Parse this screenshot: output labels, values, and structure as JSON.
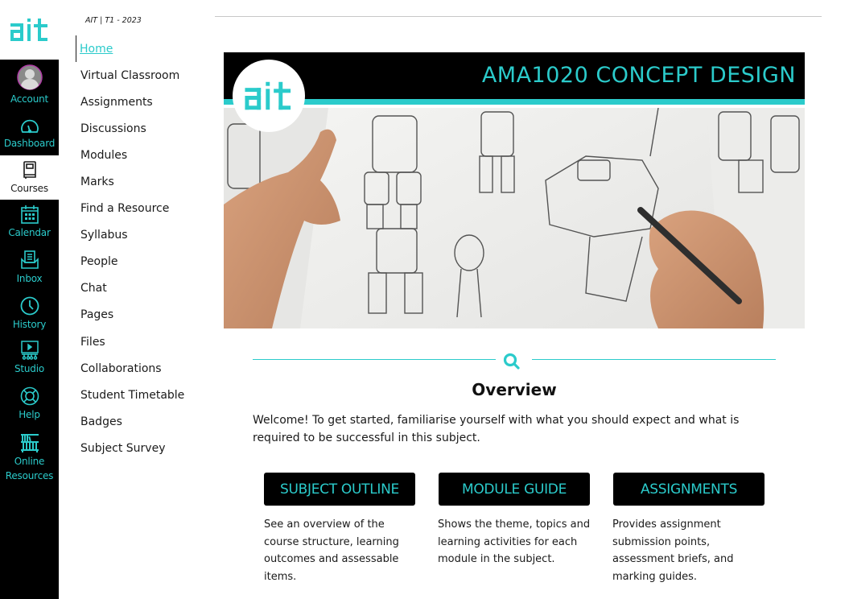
{
  "global_nav": {
    "logo_text": "ait",
    "items": [
      {
        "label": "Account",
        "icon": "avatar-icon"
      },
      {
        "label": "Dashboard",
        "icon": "speedometer-icon"
      },
      {
        "label": "Courses",
        "icon": "book-icon",
        "active": true
      },
      {
        "label": "Calendar",
        "icon": "calendar-icon"
      },
      {
        "label": "Inbox",
        "icon": "inbox-icon"
      },
      {
        "label": "History",
        "icon": "clock-icon"
      },
      {
        "label": "Studio",
        "icon": "studio-icon"
      },
      {
        "label": "Help",
        "icon": "lifebuoy-icon"
      },
      {
        "label": "Online Resources",
        "icon": "bookshelf-icon"
      }
    ]
  },
  "course_nav": {
    "term": "AIT | T1 - 2023",
    "items": [
      {
        "label": "Home",
        "active": true
      },
      {
        "label": "Virtual Classroom"
      },
      {
        "label": "Assignments"
      },
      {
        "label": "Discussions"
      },
      {
        "label": "Modules"
      },
      {
        "label": "Marks"
      },
      {
        "label": "Find a Resource"
      },
      {
        "label": "Syllabus"
      },
      {
        "label": "People"
      },
      {
        "label": "Chat"
      },
      {
        "label": "Pages"
      },
      {
        "label": "Files"
      },
      {
        "label": "Collaborations"
      },
      {
        "label": "Student Timetable"
      },
      {
        "label": "Badges"
      },
      {
        "label": "Subject Survey"
      }
    ]
  },
  "banner": {
    "title": "AMA1020 CONCEPT DESIGN",
    "logo_text": "ait",
    "image_alt": "Hands sketching robot concept designs on paper"
  },
  "overview": {
    "icon": "search-icon",
    "title": "Overview",
    "intro": "Welcome! To get started, familiarise yourself with what you should expect and what is required to be successful in this subject."
  },
  "cards": [
    {
      "button": "SUBJECT OUTLINE",
      "description": "See an overview of the course structure, learning outcomes and assessable items."
    },
    {
      "button": "MODULE GUIDE",
      "description": "Shows the theme, topics and learning activities for each module in the subject."
    },
    {
      "button": "ASSIGNMENTS",
      "description": "Provides assignment submission points, assessment briefs, and marking guides."
    }
  ],
  "colors": {
    "accent": "#2bcbcb",
    "nav_bg": "#000000",
    "text": "#1a1a1a"
  }
}
